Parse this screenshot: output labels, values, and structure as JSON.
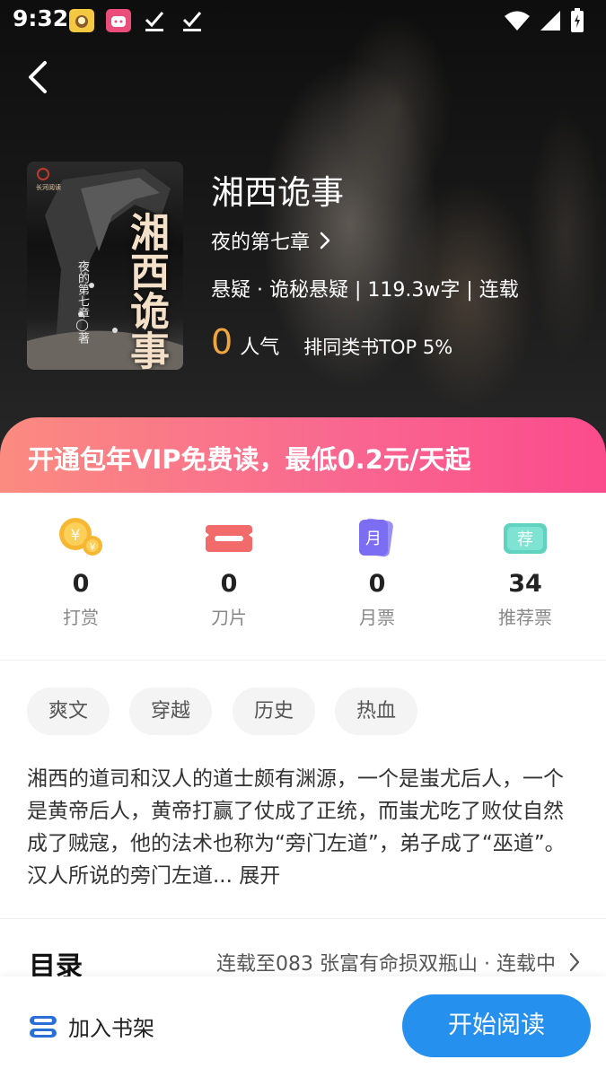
{
  "status_bar": {
    "time": "9:32"
  },
  "book": {
    "title": "湘西诡事",
    "author": "夜的第七章",
    "meta": "悬疑 · 诡秘悬疑 | 119.3w字 | 连载",
    "popularity_value": "0",
    "popularity_label": "人气",
    "rank_text": "排同类书TOP 5%",
    "cover": {
      "title_art": "湘西诡事",
      "author_text": "夜的第七章◯著",
      "publisher": "长河阅读"
    }
  },
  "vip_banner": {
    "text": "开通包年VIP免费读，最低0.2元/天起"
  },
  "stats": [
    {
      "icon": "coin-icon",
      "value": "0",
      "label": "打赏"
    },
    {
      "icon": "blade-icon",
      "value": "0",
      "label": "刀片"
    },
    {
      "icon": "monthly-ticket-icon",
      "value": "0",
      "label": "月票",
      "icon_text": "月"
    },
    {
      "icon": "recommend-ticket-icon",
      "value": "34",
      "label": "推荐票",
      "icon_text": "荐"
    }
  ],
  "tags": [
    "爽文",
    "穿越",
    "历史",
    "热血"
  ],
  "description": {
    "text": "湘西的道司和汉人的道士颇有渊源，一个是蚩尤后人，一个是黄帝后人，黄帝打赢了仗成了正统，而蚩尤吃了败仗自然成了贼寇，他的法术也称为“旁门左道”，弟子成了“巫道”。汉人所说的旁门左道...",
    "expand_label": "展开"
  },
  "toc": {
    "heading": "目录",
    "status": "连载至083 张富有命损双瓶山 · 连载中"
  },
  "bottom_bar": {
    "shelf_label": "加入书架",
    "read_label": "开始阅读"
  },
  "colors": {
    "accent_blue": "#2590ee",
    "popularity_orange": "#f0a640",
    "vip_gradient_start": "#fb8b80",
    "vip_gradient_end": "#fb4b8c"
  }
}
